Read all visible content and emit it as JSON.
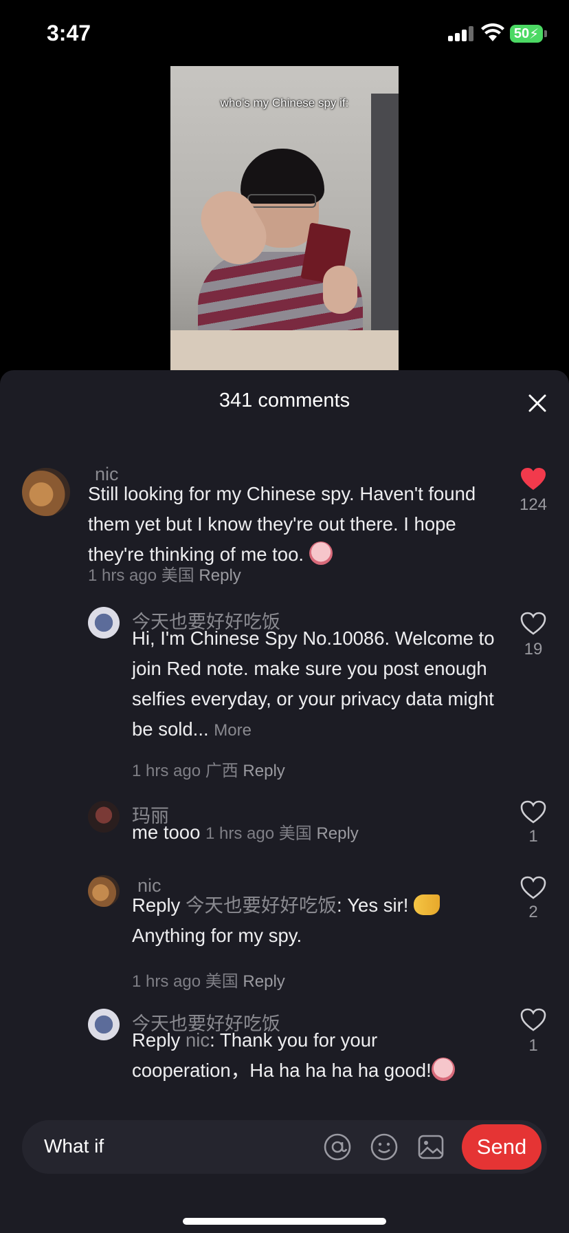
{
  "status_bar": {
    "time": "3:47",
    "battery": "50"
  },
  "video": {
    "caption": "who’s my Chinese spy if:"
  },
  "sheet": {
    "title": "341 comments"
  },
  "comments": [
    {
      "name": "nic",
      "text": "Still looking for my Chinese spy. Haven't found them yet but I know they're out there. I hope they're thinking of me too.",
      "time": "1 hrs ago",
      "location": "美国",
      "reply": "Reply",
      "likes": "124",
      "liked": true
    },
    {
      "name": "今天也要好好吃饭",
      "text": "Hi, I'm Chinese Spy No.10086. Welcome to join Red note. make sure you post enough selfies everyday, or your privacy data might be sold...",
      "more": "More",
      "time": "1 hrs ago",
      "location": "广西",
      "reply": "Reply",
      "likes": "19",
      "liked": false
    },
    {
      "name": "玛丽",
      "text": "me tooo",
      "time": "1 hrs ago",
      "location": "美国",
      "reply": "Reply",
      "likes": "1",
      "liked": false
    },
    {
      "name": "nic",
      "reply_prefix": "Reply",
      "reply_to": "今天也要好好吃饭",
      "text_line1": ": Yes sir!",
      "text_line2": "Anything for my spy.",
      "time": "1 hrs ago",
      "location": "美国",
      "reply": "Reply",
      "likes": "2",
      "liked": false
    },
    {
      "name": "今天也要好好吃饭",
      "reply_prefix": "Reply",
      "reply_to": "nic",
      "text_line1": ": Thank you for your",
      "text_line2": "cooperation，Ha ha ha ha ha good!",
      "likes": "1",
      "liked": false
    }
  ],
  "input": {
    "value": "What if",
    "send_label": "Send"
  },
  "colors": {
    "accent": "#e53434",
    "liked_heart": "#f23a4c",
    "sheet_bg": "#1c1c24"
  },
  "icons": [
    "signal-icon",
    "wifi-icon",
    "battery-icon",
    "close-icon",
    "heart-icon",
    "at-icon",
    "emoji-icon",
    "image-icon"
  ]
}
